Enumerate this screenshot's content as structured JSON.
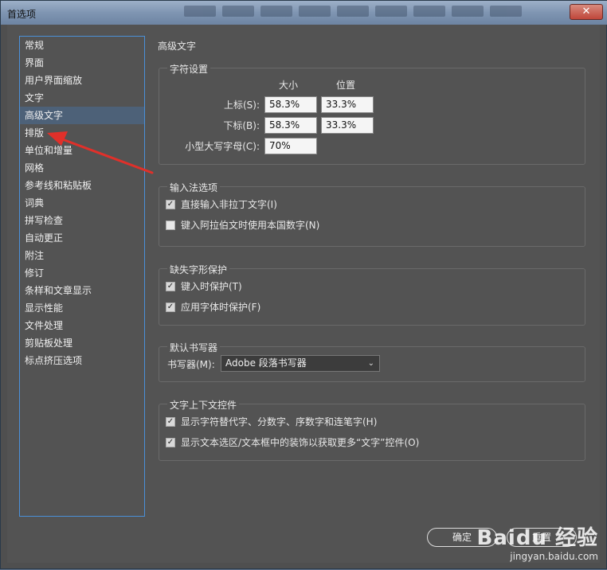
{
  "window": {
    "title": "首选项",
    "close_glyph": "✕"
  },
  "sidebar": {
    "items": [
      {
        "label": "常规"
      },
      {
        "label": "界面"
      },
      {
        "label": "用户界面缩放"
      },
      {
        "label": "文字"
      },
      {
        "label": "高级文字",
        "selected": true
      },
      {
        "label": "排版"
      },
      {
        "label": "单位和增量"
      },
      {
        "label": "网格"
      },
      {
        "label": "参考线和粘贴板"
      },
      {
        "label": "词典"
      },
      {
        "label": "拼写检查"
      },
      {
        "label": "自动更正"
      },
      {
        "label": "附注"
      },
      {
        "label": "修订"
      },
      {
        "label": "条样和文章显示"
      },
      {
        "label": "显示性能"
      },
      {
        "label": "文件处理"
      },
      {
        "label": "剪贴板处理"
      },
      {
        "label": "标点挤压选项"
      }
    ]
  },
  "panel": {
    "title": "高级文字",
    "char_settings": {
      "legend": "字符设置",
      "col_size": "大小",
      "col_position": "位置",
      "superscript_label": "上标(S):",
      "superscript_size": "58.3%",
      "superscript_position": "33.3%",
      "subscript_label": "下标(B):",
      "subscript_size": "58.3%",
      "subscript_position": "33.3%",
      "small_caps_label": "小型大写字母(C):",
      "small_caps_value": "70%"
    },
    "ime_options": {
      "legend": "输入法选项",
      "opt1_label": "直接输入非拉丁文字(I)",
      "opt1_checked": true,
      "opt2_label": "键入阿拉伯文时使用本国数字(N)",
      "opt2_checked": false
    },
    "missing_glyph": {
      "legend": "缺失字形保护",
      "opt1_label": "键入时保护(T)",
      "opt1_checked": true,
      "opt2_label": "应用字体时保护(F)",
      "opt2_checked": true
    },
    "default_composer": {
      "legend": "默认书写器",
      "composer_label": "书写器(M):",
      "composer_value": "Adobe 段落书写器"
    },
    "context_controls": {
      "legend": "文字上下文控件",
      "opt1_label": "显示字符替代字、分数字、序数字和连笔字(H)",
      "opt1_checked": true,
      "opt2_label": "显示文本选区/文本框中的装饰以获取更多“文字”控件(O)",
      "opt2_checked": true
    }
  },
  "buttons": {
    "ok": "确定",
    "reset": "重置"
  },
  "watermark": {
    "logo": "Baidu 经验",
    "url": "jingyan.baidu.com"
  },
  "annotation": {
    "arrow_color": "#e0302a"
  },
  "check_glyph": "✓"
}
